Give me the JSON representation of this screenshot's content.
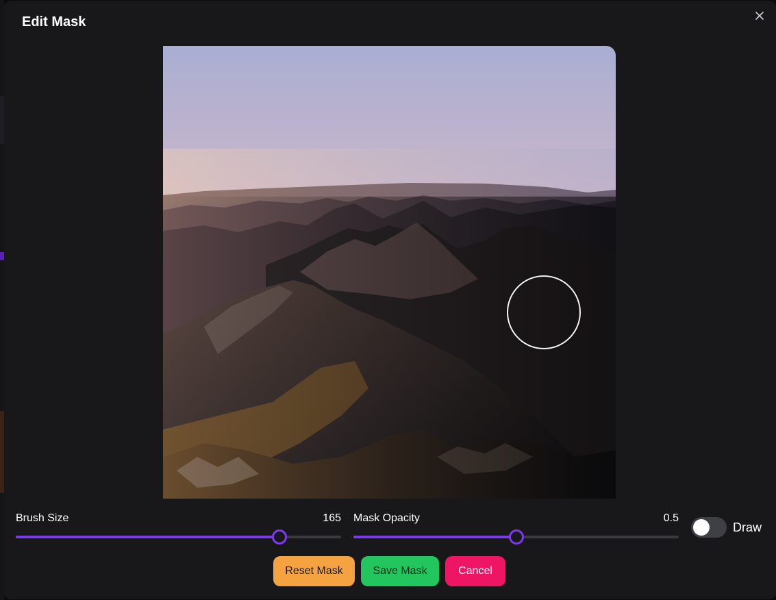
{
  "modal": {
    "title": "Edit Mask"
  },
  "controls": {
    "brush_size": {
      "label": "Brush Size",
      "value": "165",
      "fraction": 0.81
    },
    "mask_opacity": {
      "label": "Mask Opacity",
      "value": "0.5",
      "fraction": 0.5
    },
    "mode_toggle": {
      "label": "Draw",
      "on": false
    }
  },
  "buttons": {
    "reset": "Reset Mask",
    "save": "Save Mask",
    "cancel": "Cancel"
  },
  "colors": {
    "accent": "#7c3aed",
    "reset": "#f4a340",
    "save": "#22c55e",
    "cancel": "#ef1565"
  },
  "icons": {
    "close": "close-icon"
  }
}
